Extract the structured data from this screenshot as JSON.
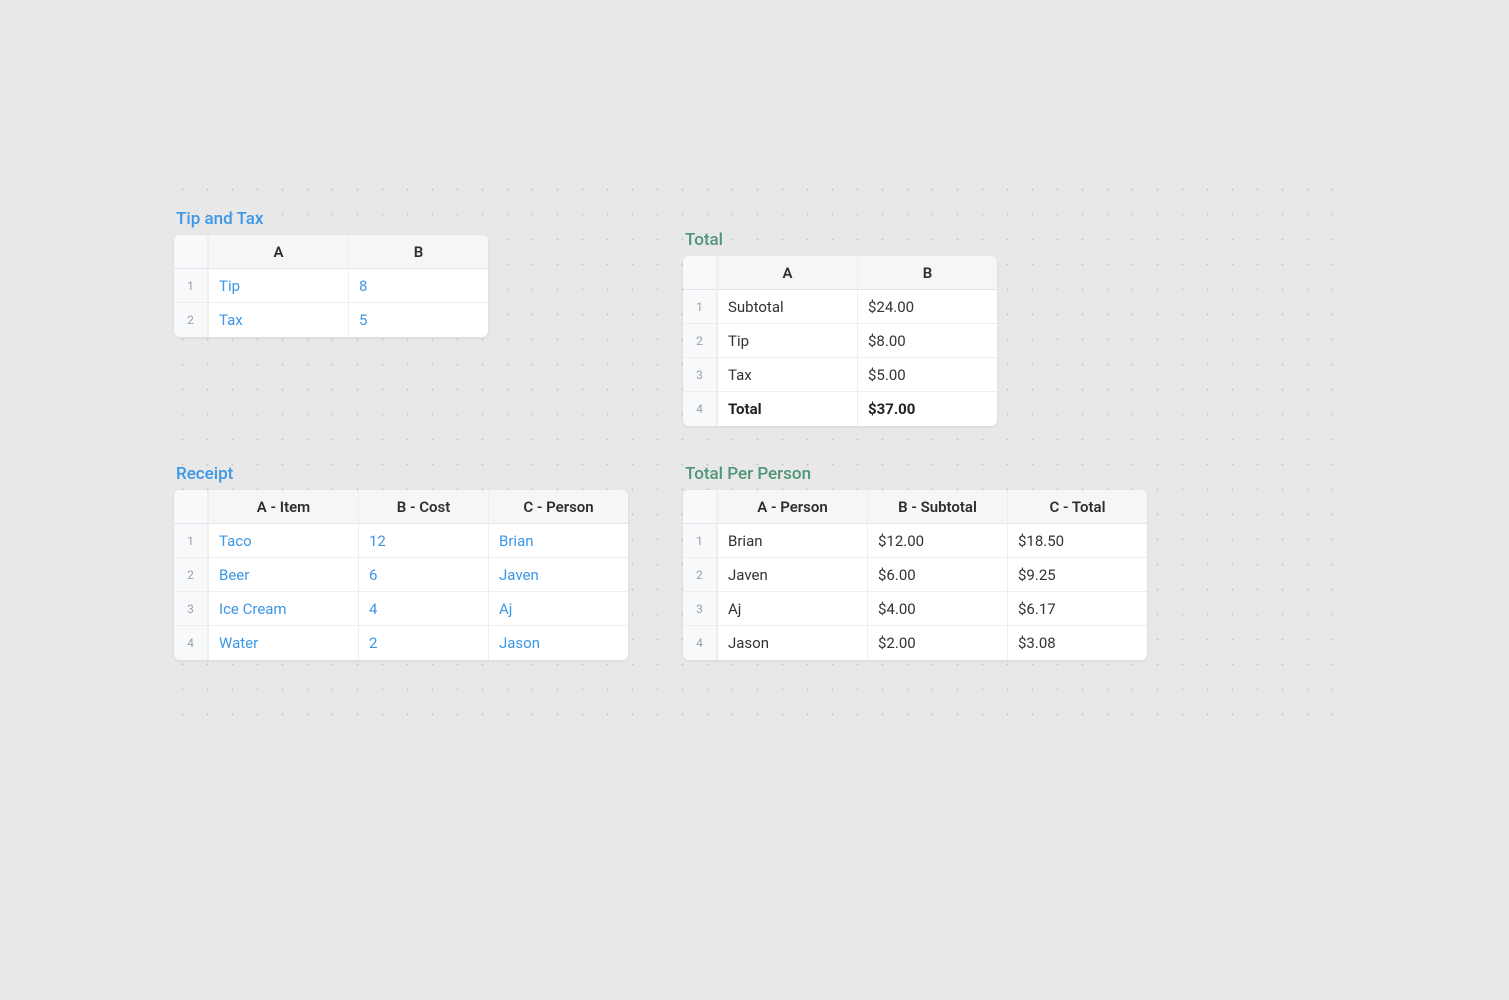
{
  "tipTax": {
    "title": "Tip and Tax",
    "columns": [
      "A",
      "B"
    ],
    "rows": [
      {
        "n": "1",
        "label": "Tip",
        "value": "8"
      },
      {
        "n": "2",
        "label": "Tax",
        "value": "5"
      }
    ]
  },
  "total": {
    "title": "Total",
    "columns": [
      "A",
      "B"
    ],
    "rows": [
      {
        "n": "1",
        "label": "Subtotal",
        "value": "$24.00",
        "bold": false
      },
      {
        "n": "2",
        "label": "Tip",
        "value": "$8.00",
        "bold": false
      },
      {
        "n": "3",
        "label": "Tax",
        "value": "$5.00",
        "bold": false
      },
      {
        "n": "4",
        "label": "Total",
        "value": "$37.00",
        "bold": true
      }
    ]
  },
  "receipt": {
    "title": "Receipt",
    "columns": [
      "A - Item",
      "B - Cost",
      "C - Person"
    ],
    "rows": [
      {
        "n": "1",
        "item": "Taco",
        "cost": "12",
        "person": "Brian"
      },
      {
        "n": "2",
        "item": "Beer",
        "cost": "6",
        "person": "Javen"
      },
      {
        "n": "3",
        "item": "Ice Cream",
        "cost": "4",
        "person": "Aj"
      },
      {
        "n": "4",
        "item": "Water",
        "cost": "2",
        "person": "Jason"
      }
    ]
  },
  "perPerson": {
    "title": "Total Per Person",
    "columns": [
      "A - Person",
      "B - Subtotal",
      "C - Total"
    ],
    "rows": [
      {
        "n": "1",
        "person": "Brian",
        "subtotal": "$12.00",
        "total": "$18.50"
      },
      {
        "n": "2",
        "person": "Javen",
        "subtotal": "$6.00",
        "total": "$9.25"
      },
      {
        "n": "3",
        "person": "Aj",
        "subtotal": "$4.00",
        "total": "$6.17"
      },
      {
        "n": "4",
        "person": "Jason",
        "subtotal": "$2.00",
        "total": "$3.08"
      }
    ]
  }
}
